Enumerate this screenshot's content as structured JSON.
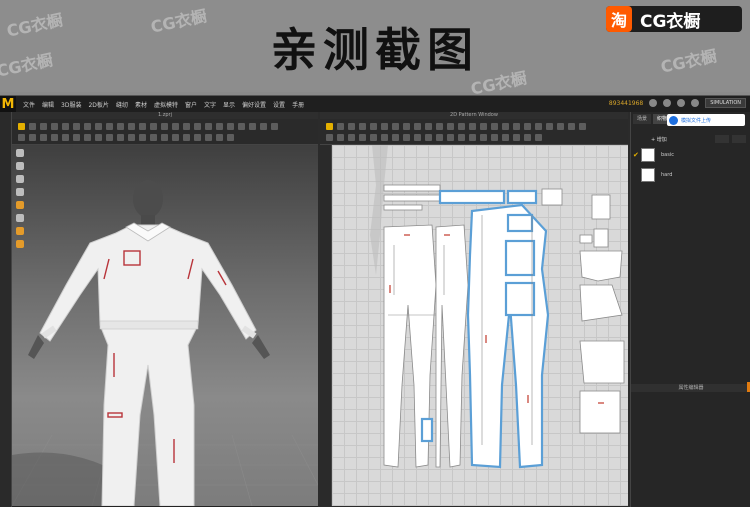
{
  "banner": {
    "title": "亲测截图",
    "watermark": "CG衣橱",
    "brand_tao": "淘",
    "brand_name": "CG衣橱"
  },
  "menubar": {
    "logo": "M",
    "items": [
      "文件",
      "编辑",
      "3D服装",
      "2D板片",
      "缝纫",
      "素材",
      "虚拟模特",
      "窗户",
      "文字",
      "显示",
      "偏好设置",
      "设置",
      "手册"
    ],
    "serial": "893441968",
    "simulation": "SIMULATION"
  },
  "panel3d": {
    "title": "1.zprj"
  },
  "panel2d": {
    "title": "2D Pattern Window"
  },
  "browser": {
    "tabs": [
      "场景",
      "织物"
    ],
    "cloud_label": "模拟文件上传",
    "add_label": "+ 增加",
    "fabrics": [
      "basic",
      "hard"
    ],
    "property_header": "属性编辑器"
  },
  "colors": {
    "accent": "#e4b000",
    "pattern_outline": "#5b9fd6",
    "stitch": "#c0392b"
  }
}
